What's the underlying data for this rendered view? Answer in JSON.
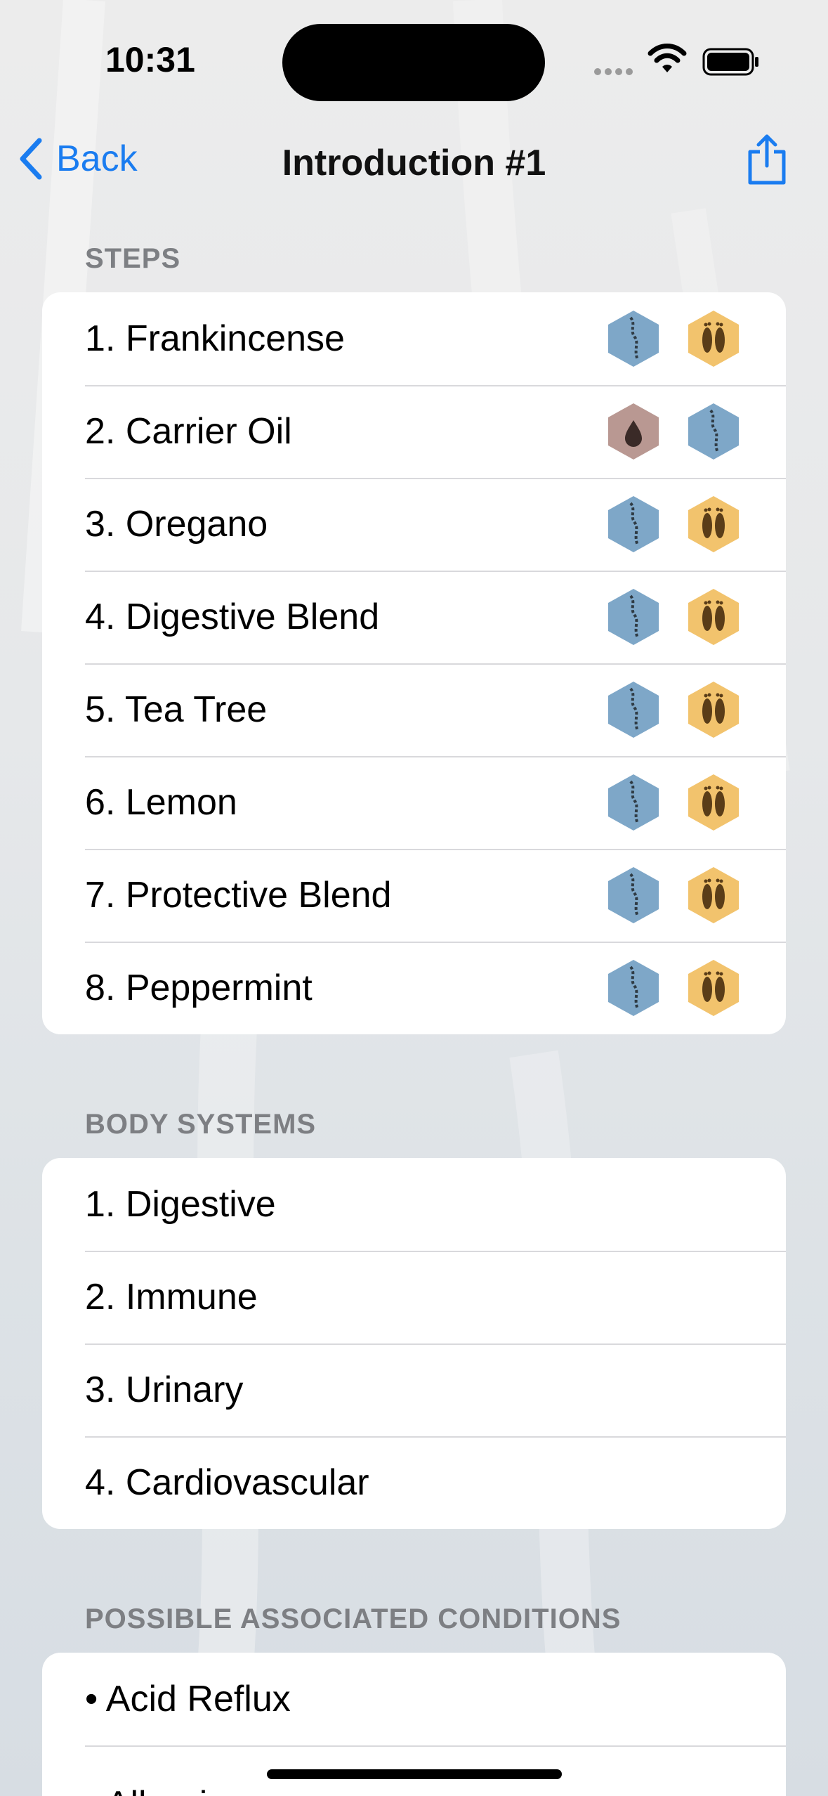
{
  "status": {
    "time": "10:31"
  },
  "nav": {
    "back_label": "Back",
    "title": "Introduction #1"
  },
  "colors": {
    "accent": "#1a7cf0",
    "spine_hex": "#7ea7c8",
    "feet_hex": "#f2c36d",
    "drop_hex": "#b99892"
  },
  "sections": {
    "steps": {
      "header": "STEPS",
      "items": [
        {
          "label": "1. Frankincense",
          "icons": [
            "spine-icon",
            "feet-icon"
          ]
        },
        {
          "label": "2. Carrier Oil",
          "icons": [
            "drop-icon",
            "spine-icon"
          ]
        },
        {
          "label": "3. Oregano",
          "icons": [
            "spine-icon",
            "feet-icon"
          ]
        },
        {
          "label": "4. Digestive Blend",
          "icons": [
            "spine-icon",
            "feet-icon"
          ]
        },
        {
          "label": "5. Tea Tree",
          "icons": [
            "spine-icon",
            "feet-icon"
          ]
        },
        {
          "label": "6. Lemon",
          "icons": [
            "spine-icon",
            "feet-icon"
          ]
        },
        {
          "label": "7. Protective Blend",
          "icons": [
            "spine-icon",
            "feet-icon"
          ]
        },
        {
          "label": "8. Peppermint",
          "icons": [
            "spine-icon",
            "feet-icon"
          ]
        }
      ]
    },
    "body_systems": {
      "header": "BODY SYSTEMS",
      "items": [
        {
          "label": "1. Digestive"
        },
        {
          "label": "2. Immune"
        },
        {
          "label": "3. Urinary"
        },
        {
          "label": "4. Cardiovascular"
        }
      ]
    },
    "conditions": {
      "header": "POSSIBLE ASSOCIATED CONDITIONS",
      "items": [
        {
          "label": "• Acid Reflux"
        },
        {
          "label": "• Allergies"
        }
      ]
    }
  }
}
